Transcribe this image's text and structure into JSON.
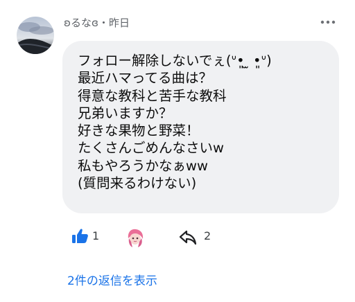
{
  "comment": {
    "author": "ʚるなɞ",
    "separator": "・",
    "time": "昨日",
    "lines": [
      "フォロー解除しないでぇ(ᐡ•͈ ̫ •͈ᐡ)",
      "最近ハマってる曲は？",
      "得意な教科と苦手な教科",
      "兄弟いますか？",
      "好きな果物と野菜！",
      "たくさんごめんなさいw",
      "私もやろうかなぁww",
      "(質問来るわけない)"
    ]
  },
  "actions": {
    "like_icon": "thumbs-up-icon",
    "like_count": "1",
    "reaction_icon": "reaction-avatar",
    "share_icon": "share-arrow-icon",
    "share_count": "2"
  },
  "replies_link": "2件の返信を表示",
  "icons": {
    "more": "more-horizontal-icon"
  },
  "colors": {
    "bubble": "#f0f1f3",
    "accent": "#1a73e8",
    "muted": "#5f6368"
  }
}
